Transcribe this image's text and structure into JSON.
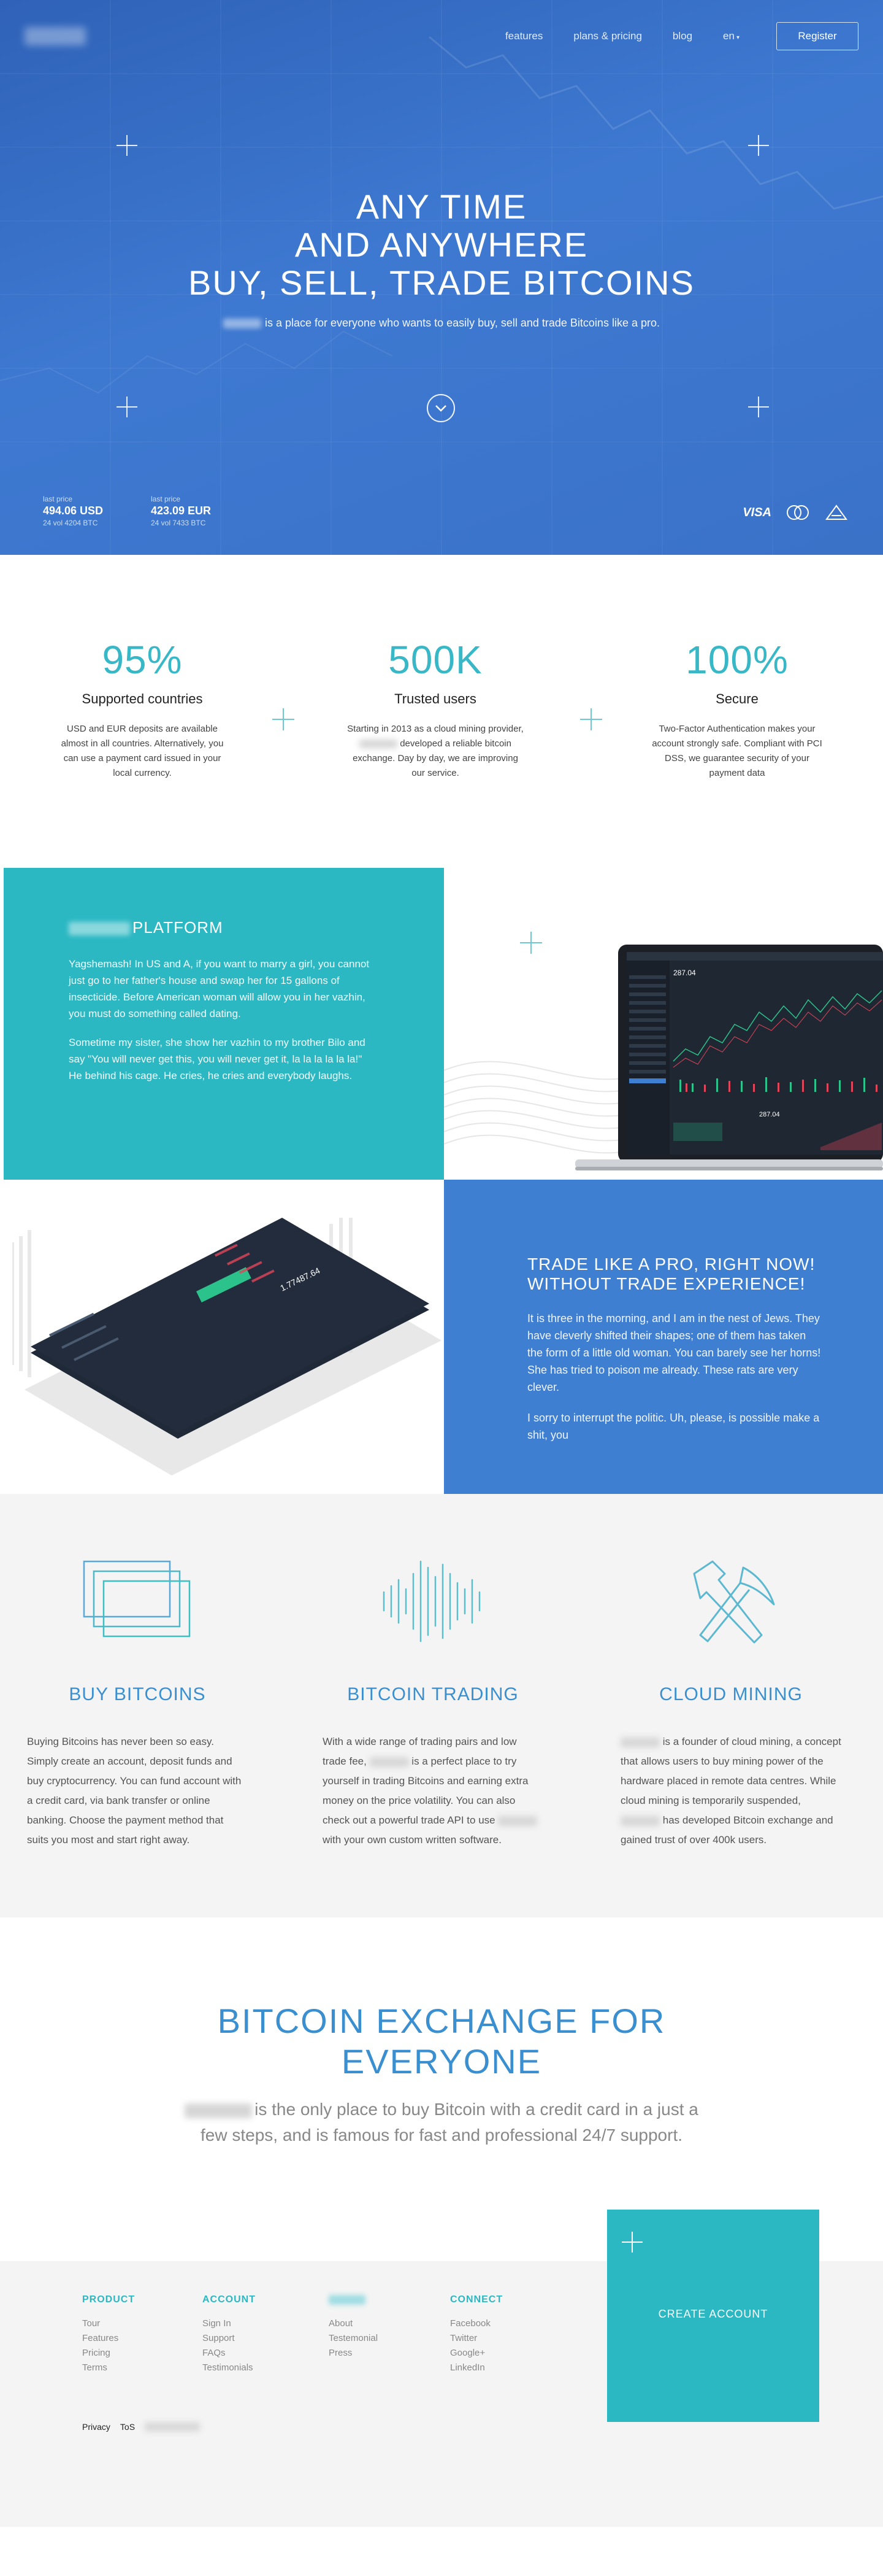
{
  "nav": {
    "links": [
      "features",
      "plans & pricing",
      "blog"
    ],
    "lang": "en",
    "register": "Register"
  },
  "hero": {
    "title_lines": [
      "ANY TIME",
      "AND ANYWHERE",
      "BUY, SELL, TRADE BITCOINS"
    ],
    "subtitle": "is a place for everyone who wants to easily buy, sell and trade Bitcoins like a pro.",
    "prices": [
      {
        "label": "last price",
        "value": "494.06 USD",
        "vol_prefix": "24 vol",
        "vol": "4204 BTC"
      },
      {
        "label": "last price",
        "value": "423.09 EUR",
        "vol_prefix": "24 vol",
        "vol": "7433 BTC"
      }
    ],
    "payment_logos": [
      "VISA",
      "mastercard",
      "SEPA"
    ]
  },
  "stats": [
    {
      "number": "95%",
      "title": "Supported countries",
      "text": "USD and EUR deposits are available almost in all countries. Alternatively, you can use a payment card issued in your local currency."
    },
    {
      "number": "500K",
      "title": "Trusted users",
      "text_before": "Starting in 2013 as a cloud mining provider,",
      "text_after": "developed a reliable bitcoin exchange. Day by day, we are improving our service."
    },
    {
      "number": "100%",
      "title": "Secure",
      "text": "Two-Factor Authentication makes your account strongly safe. Compliant with PCI DSS, we guarantee security of your payment data"
    }
  ],
  "platform": {
    "title": "PLATFORM",
    "paragraphs": [
      "Yagshemash! In US and A, if you want to marry a girl, you cannot just go to her father's house and swap her for 15 gallons of insecticide. Before American woman will allow you in her vazhin, you must do something called dating.",
      "Sometime my sister, she show her vazhin to my brother Bilo and say \"You will never get this, you will never get it, la la la la la la!\" He behind his cage. He cries, he cries and everybody laughs."
    ],
    "screen_price": "287.04",
    "screen_price2": "287.04"
  },
  "trade": {
    "title_lines": [
      "TRADE LIKE A PRO, RIGHT NOW!",
      "WITHOUT TRADE EXPERIENCE!"
    ],
    "paragraphs": [
      "It is three in the morning, and I am in the nest of Jews. They have cleverly shifted their shapes; one of them has taken the form of a little old woman. You can barely see her horns! She has tried to poison me already. These rats are very clever.",
      "I sorry to interrupt the politic. Uh, please, is possible make a shit, you"
    ],
    "phone_value": "1.77487.64"
  },
  "features": [
    {
      "icon": "cards-icon",
      "title": "BUY BITCOINS",
      "text": "Buying Bitcoins has never been so easy. Simply create an account, deposit funds and buy cryptocurrency. You can fund account with a credit card, via bank transfer or online banking. Choose the payment method that suits you most and start right away."
    },
    {
      "icon": "waveform-icon",
      "title": "BITCOIN TRADING",
      "text_parts": [
        "With a wide range of trading pairs and low trade fee,",
        "is a perfect place to try yourself in trading Bitcoins and earning extra money on the price volatility. You can also check out a powerful trade API to use",
        "with your own custom written software."
      ]
    },
    {
      "icon": "pickaxe-hammer-icon",
      "title": "CLOUD MINING",
      "text_parts": [
        "is a founder of cloud mining, a concept that allows users to buy mining power of the hardware placed in remote data centres. While cloud mining is temporarily suspended,",
        "has developed Bitcoin exchange and gained trust of over 400k users."
      ]
    }
  ],
  "exchange": {
    "title_lines": [
      "BITCOIN EXCHANGE FOR",
      "EVERYONE"
    ],
    "subtitle_line1": "is the only place to buy Bitcoin with a credit card in a just a",
    "subtitle_line2": "few steps, and is famous for fast and professional 24/7 support."
  },
  "footer": {
    "columns": [
      {
        "title": "PRODUCT",
        "links": [
          "Tour",
          "Features",
          "Pricing",
          "Terms"
        ]
      },
      {
        "title": "ACCOUNT",
        "links": [
          "Sign In",
          "Support",
          "FAQs",
          "Testimonials"
        ]
      },
      {
        "title": "",
        "links": [
          "About",
          "Testemonial",
          "Press"
        ]
      },
      {
        "title": "CONNECT",
        "links": [
          "Facebook",
          "Twitter",
          "Google+",
          "LinkedIn"
        ]
      }
    ],
    "bottom_links": [
      "Privacy",
      "ToS"
    ],
    "cta": "CREATE ACCOUNT"
  },
  "colors": {
    "hero_blue": "#3a72c8",
    "teal": "#2bb8c3",
    "trade_blue": "#3f7fd2",
    "title_blue": "#3a8fd0",
    "stat_teal": "#38b8c6"
  }
}
